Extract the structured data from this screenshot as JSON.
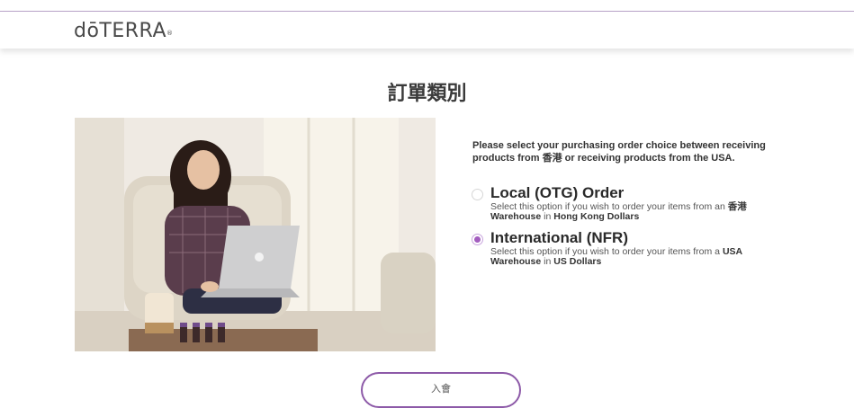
{
  "header": {
    "logo_text": "dōTERRA",
    "logo_mark": "®"
  },
  "page": {
    "title": "訂單類別"
  },
  "prompt": "Please select your purchasing order choice between receiving products from 香港 or receiving products from the USA.",
  "options": [
    {
      "title": "Local (OTG) Order",
      "desc_pre": "Select this option if you wish to order your items from an ",
      "desc_bold1": "香港 Warehouse",
      "desc_mid": " in ",
      "desc_bold2": "Hong Kong Dollars",
      "selected": false
    },
    {
      "title": "International (NFR)",
      "desc_pre": "Select this option if you wish to order your items from a ",
      "desc_bold1": "USA Warehouse",
      "desc_mid": " in ",
      "desc_bold2": "US Dollars",
      "selected": true
    }
  ],
  "join_button": {
    "label": "入會"
  },
  "colors": {
    "accent": "#a35dbf",
    "button_border": "#8d5aa8",
    "header_rule": "#b9a3c9"
  }
}
